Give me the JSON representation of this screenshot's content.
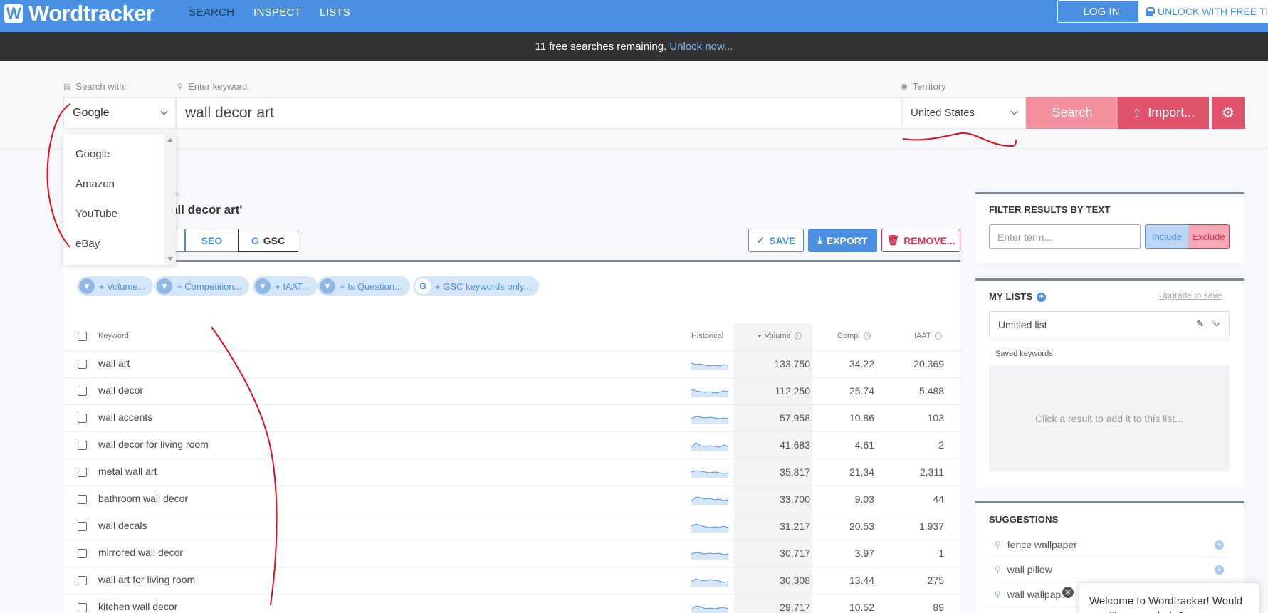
{
  "nav": {
    "logo_mark": "W",
    "logo_text": "Wordtracker",
    "links": [
      "SEARCH",
      "INSPECT",
      "LISTS"
    ],
    "login": "LOG IN",
    "unlock": "UNLOCK WITH FREE TI"
  },
  "banner": {
    "text": "11 free searches remaining.",
    "link": "Unlock now..."
  },
  "search": {
    "search_with_label": "Search with:",
    "keyword_label": "Enter keyword",
    "territory_label": "Territory",
    "engine": "Google",
    "keyword": "wall decor art",
    "territory": "United States",
    "search_btn": "Search",
    "import_btn": "Import...",
    "engine_options": [
      "Google",
      "Amazon",
      "YouTube",
      "eBay"
    ]
  },
  "results": {
    "hint": "able...",
    "title": "all decor art'",
    "tabs": {
      "seo": "SEO",
      "gsc": "GSC"
    },
    "save": "SAVE",
    "export": "EXPORT",
    "remove": "REMOVE...",
    "chips": [
      "+ Volume...",
      "+ Competition...",
      "+ IAAT...",
      "+ Is Question...",
      "+ GSC keywords only..."
    ],
    "headers": {
      "keyword": "Keyword",
      "historical": "Historical",
      "volume": "Volume",
      "comp": "Comp.",
      "iaat": "IAAT"
    },
    "rows": [
      {
        "keyword": "wall art",
        "volume": "133,750",
        "comp": "34.22",
        "iaat": "20,369"
      },
      {
        "keyword": "wall decor",
        "volume": "112,250",
        "comp": "25.74",
        "iaat": "5,488"
      },
      {
        "keyword": "wall accents",
        "volume": "57,958",
        "comp": "10.86",
        "iaat": "103"
      },
      {
        "keyword": "wall decor for living room",
        "volume": "41,683",
        "comp": "4.61",
        "iaat": "2"
      },
      {
        "keyword": "metal wall art",
        "volume": "35,817",
        "comp": "21.34",
        "iaat": "2,311"
      },
      {
        "keyword": "bathroom wall decor",
        "volume": "33,700",
        "comp": "9.03",
        "iaat": "44"
      },
      {
        "keyword": "wall decals",
        "volume": "31,217",
        "comp": "20.53",
        "iaat": "1,937"
      },
      {
        "keyword": "mirrored wall decor",
        "volume": "30,717",
        "comp": "3.97",
        "iaat": "1"
      },
      {
        "keyword": "wall art for living room",
        "volume": "30,308",
        "comp": "13.44",
        "iaat": "275"
      },
      {
        "keyword": "kitchen wall decor",
        "volume": "29,717",
        "comp": "10.52",
        "iaat": "89"
      }
    ]
  },
  "sidebar": {
    "filter_title": "FILTER RESULTS BY TEXT",
    "filter_placeholder": "Enter term...",
    "include": "Include",
    "exclude": "Exclude",
    "lists_title": "MY LISTS",
    "upgrade": "Upgrade to save",
    "list_name": "Untitled list",
    "saved_label": "Saved keywords",
    "saved_empty": "Click a result to add it to this list...",
    "suggestions_title": "SUGGESTIONS",
    "suggestions": [
      "fence wallpaper",
      "wall pillow",
      "wall wallpaper"
    ]
  },
  "chat": {
    "text": "Welcome to Wordtracker! Would you like some help?"
  },
  "colors": {
    "brand_blue": "#4a90e2",
    "search_pink": "#f4919e",
    "import_red": "#e0536b",
    "annotation_red": "#e0101a"
  }
}
